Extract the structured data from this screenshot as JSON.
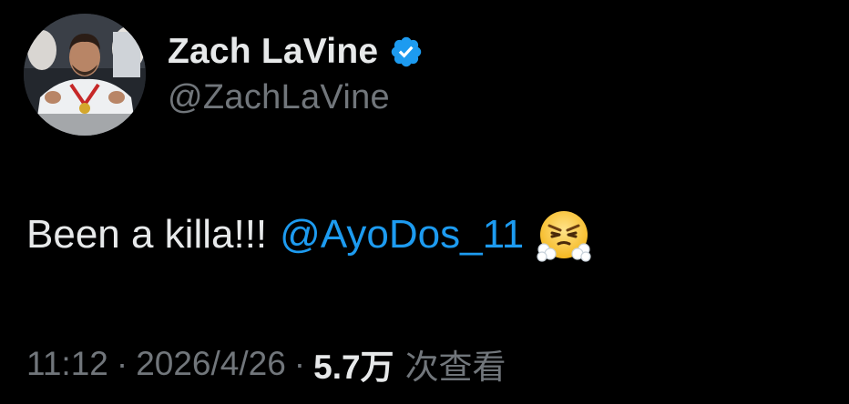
{
  "tweet": {
    "author": {
      "display_name": "Zach LaVine",
      "handle": "@ZachLaVine",
      "verified_icon": "verified-badge-icon",
      "avatar": "avatar-photo"
    },
    "body": {
      "text": "Been a killa!!!",
      "mention": "@AyoDos_11",
      "emoji": "face-with-steam-from-nose-emoji"
    },
    "meta": {
      "time": "11:12",
      "separator": "·",
      "date": "2026/4/26",
      "views_count": "5.7万",
      "views_label": "次查看"
    }
  },
  "colors": {
    "background": "#000000",
    "primary_text": "#e7e9ea",
    "secondary_text": "#71767b",
    "link": "#1d9bf0",
    "verified": "#1d9bf0"
  }
}
